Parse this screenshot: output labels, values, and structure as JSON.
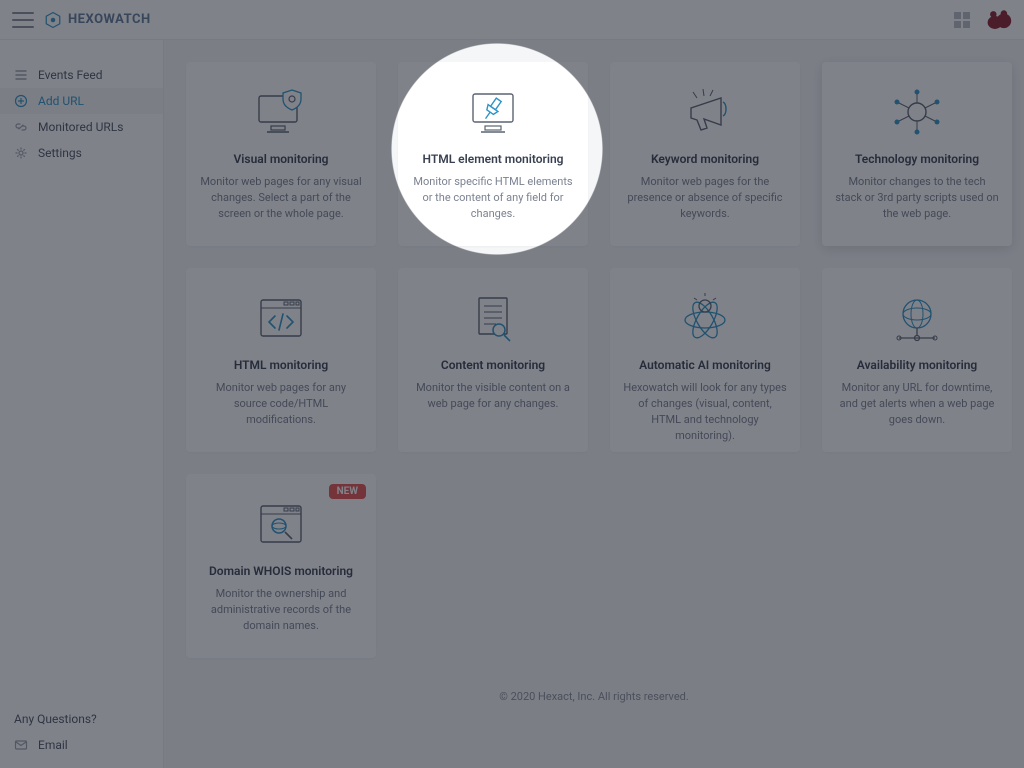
{
  "brand": "HEXOWATCH",
  "sidebar": {
    "items": [
      {
        "label": "Events Feed"
      },
      {
        "label": "Add URL"
      },
      {
        "label": "Monitored URLs"
      },
      {
        "label": "Settings"
      }
    ],
    "questions": "Any Questions?",
    "email": "Email"
  },
  "cards": [
    {
      "title": "Visual monitoring",
      "desc": "Monitor web pages for any visual changes. Select a part of the screen or the whole page."
    },
    {
      "title": "HTML element monitoring",
      "desc": "Monitor specific HTML elements or the content of any field for changes."
    },
    {
      "title": "Keyword monitoring",
      "desc": "Monitor web pages for the presence or absence of specific keywords."
    },
    {
      "title": "Technology monitoring",
      "desc": "Monitor changes to the tech stack or 3rd party scripts used on the web page."
    },
    {
      "title": "HTML monitoring",
      "desc": "Monitor web pages for any source code/HTML modifications."
    },
    {
      "title": "Content monitoring",
      "desc": "Monitor the visible content on a web page for any changes."
    },
    {
      "title": "Automatic AI monitoring",
      "desc": "Hexowatch will look for any types of changes (visual, content, HTML and technology monitoring)."
    },
    {
      "title": "Availability monitoring",
      "desc": "Monitor any URL for downtime, and get alerts when a web page goes down."
    },
    {
      "title": "Domain WHOIS monitoring",
      "desc": "Monitor the ownership and administrative records of the domain names.",
      "badge": "NEW"
    }
  ],
  "footer": "© 2020 Hexact, Inc. All rights reserved.",
  "colors": {
    "accent": "#2d94c7",
    "danger": "#e5524e"
  }
}
